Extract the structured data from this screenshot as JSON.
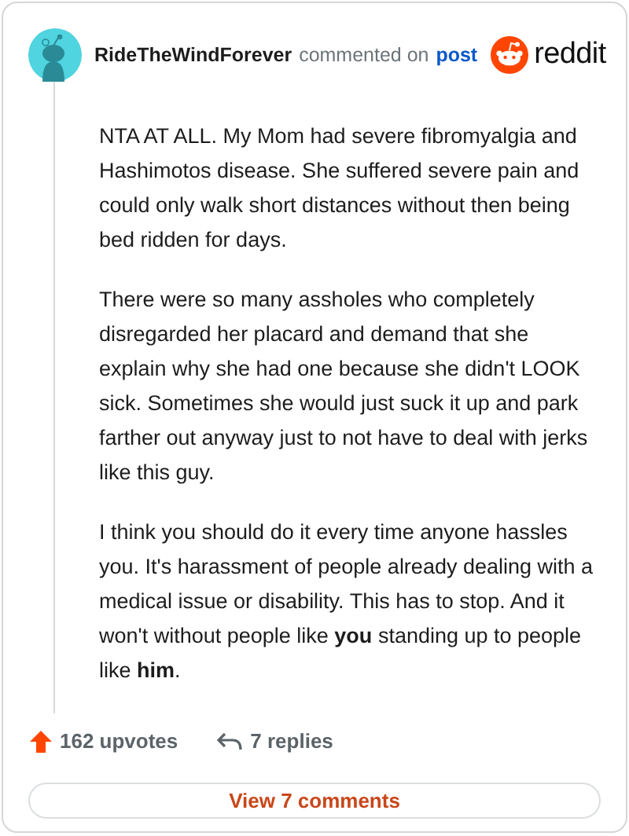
{
  "header": {
    "username": "RideTheWindForever",
    "action": "commented on",
    "link": "post",
    "logo_text": "reddit"
  },
  "paragraphs": [
    "NTA AT ALL. My Mom had severe fibromyalgia and Hashimotos disease. She suffered severe pain and could only walk short distances without then being bed ridden for days.",
    "There were so many assholes who completely disregarded her placard and demand that she explain why she had one because she didn't LOOK sick. Sometimes she would just suck it up and park farther out anyway just to not have to deal with jerks like this guy.",
    "I think you should do it every time anyone hassles you. It's harassment of people already dealing with a medical issue or disability. This has to stop. And it won't without people like **you** standing up to people like **him**."
  ],
  "footer": {
    "upvotes": "162 upvotes",
    "replies": "7 replies",
    "button": "View 7 comments"
  }
}
